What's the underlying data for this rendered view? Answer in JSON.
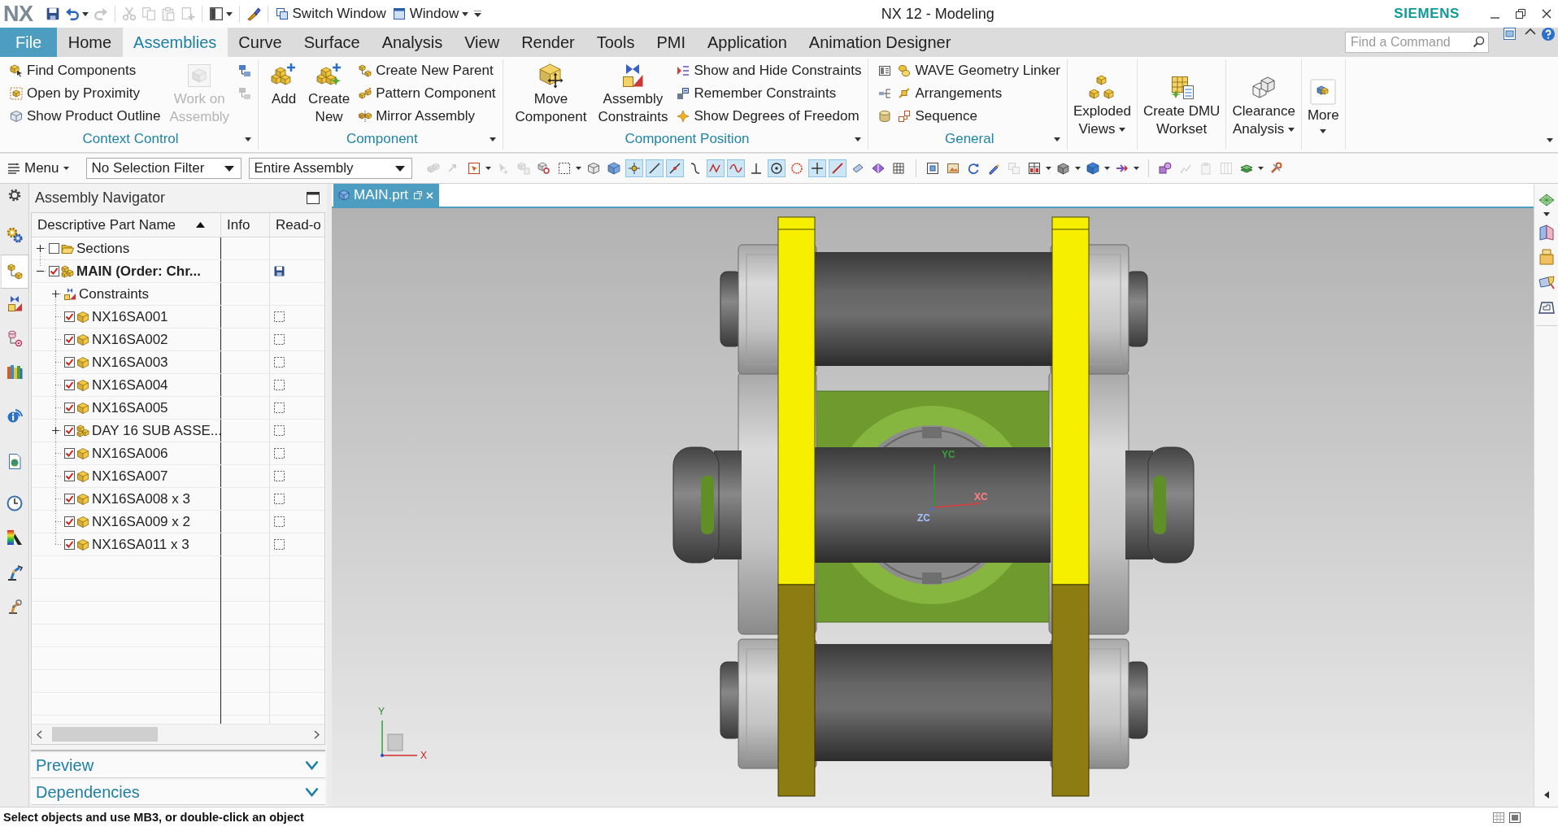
{
  "title_bar": {
    "logo": "NX",
    "quick_access": [
      {
        "kind": "icon",
        "disabled": false,
        "dropdown": false
      },
      {
        "kind": "icon",
        "disabled": false,
        "dropdown": true
      },
      {
        "kind": "icon",
        "disabled": true,
        "dropdown": false
      },
      {
        "kind": "icon",
        "disabled": true,
        "dropdown": false
      },
      {
        "kind": "icon",
        "disabled": true,
        "dropdown": false
      },
      {
        "kind": "icon",
        "disabled": true,
        "dropdown": false
      },
      {
        "kind": "icon",
        "disabled": true,
        "dropdown": false
      },
      {
        "kind": "icon",
        "disabled": false,
        "dropdown": true
      },
      {
        "kind": "icon",
        "disabled": false,
        "dropdown": false
      },
      {
        "kind": "button",
        "label": "Switch Window",
        "disabled": false,
        "dropdown": false
      },
      {
        "kind": "button",
        "label": "Window",
        "disabled": false,
        "dropdown": true
      }
    ],
    "title": "NX 12 - Modeling",
    "brand": "SIEMENS"
  },
  "ribbon_tabs": [
    {
      "label": "File",
      "kind": "backstage",
      "selected": false
    },
    {
      "label": "Home",
      "kind": "tab",
      "selected": false
    },
    {
      "label": "Assemblies",
      "kind": "tab",
      "selected": true
    },
    {
      "label": "Curve",
      "kind": "tab",
      "selected": false
    },
    {
      "label": "Surface",
      "kind": "tab",
      "selected": false
    },
    {
      "label": "Analysis",
      "kind": "tab",
      "selected": false
    },
    {
      "label": "View",
      "kind": "tab",
      "selected": false
    },
    {
      "label": "Render",
      "kind": "tab",
      "selected": false
    },
    {
      "label": "Tools",
      "kind": "tab",
      "selected": false
    },
    {
      "label": "PMI",
      "kind": "tab",
      "selected": false
    },
    {
      "label": "Application",
      "kind": "tab",
      "selected": false
    },
    {
      "label": "Animation Designer",
      "kind": "tab",
      "selected": false
    }
  ],
  "command_search": {
    "placeholder": "Find a Command"
  },
  "ribbon_groups": [
    {
      "label": "Context Control",
      "controls": [
        {
          "kind": "stack",
          "items": [
            {
              "label": "Find Components",
              "disabled": false
            },
            {
              "label": "Open by Proximity",
              "disabled": false
            },
            {
              "label": "Show Product Outline",
              "disabled": false
            }
          ]
        },
        {
          "kind": "large",
          "label": "Work on\nAssembly",
          "disabled": true,
          "dropdown": false
        },
        {
          "kind": "icons",
          "items": [
            {
              "disabled": false
            },
            {
              "disabled": true
            }
          ]
        }
      ]
    },
    {
      "label": "Component",
      "controls": [
        {
          "kind": "large",
          "label": "Add",
          "disabled": false,
          "dropdown": false
        },
        {
          "kind": "large",
          "label": "Create\nNew",
          "disabled": false,
          "dropdown": false
        },
        {
          "kind": "stack",
          "items": [
            {
              "label": "Create New Parent",
              "disabled": false
            },
            {
              "label": "Pattern Component",
              "disabled": false
            },
            {
              "label": "Mirror Assembly",
              "disabled": false
            }
          ]
        }
      ]
    },
    {
      "label": "Component Position",
      "controls": [
        {
          "kind": "large",
          "label": "Move\nComponent",
          "disabled": false,
          "dropdown": false
        },
        {
          "kind": "large",
          "label": "Assembly\nConstraints",
          "disabled": false,
          "dropdown": false
        },
        {
          "kind": "stack",
          "items": [
            {
              "label": "Show and Hide Constraints",
              "disabled": false
            },
            {
              "label": "Remember Constraints",
              "disabled": false
            },
            {
              "label": "Show Degrees of Freedom",
              "disabled": false
            }
          ]
        }
      ]
    },
    {
      "label": "General",
      "controls": [
        {
          "kind": "icons",
          "items": [
            {
              "disabled": false
            },
            {
              "disabled": false
            },
            {
              "disabled": false
            }
          ]
        },
        {
          "kind": "stack",
          "items": [
            {
              "label": "WAVE Geometry Linker",
              "disabled": false
            },
            {
              "label": "Arrangements",
              "disabled": false
            },
            {
              "label": "Sequence",
              "disabled": false
            }
          ]
        }
      ]
    },
    {
      "controls": [
        {
          "kind": "large",
          "label": "Exploded\nViews",
          "disabled": false,
          "dropdown": true
        }
      ]
    },
    {
      "controls": [
        {
          "kind": "large",
          "label": "Create DMU\nWorkset",
          "disabled": false,
          "dropdown": false
        }
      ]
    },
    {
      "controls": [
        {
          "kind": "large",
          "label": "Clearance\nAnalysis",
          "disabled": false,
          "dropdown": true
        }
      ]
    },
    {
      "controls": [
        {
          "kind": "large",
          "label": "More",
          "disabled": false,
          "dropdown": true
        }
      ]
    }
  ],
  "selection_bar": {
    "menu": "Menu",
    "filters": [
      {
        "value": "No Selection Filter"
      },
      {
        "value": "Entire Assembly"
      }
    ],
    "tools": [
      {
        "on": false,
        "disabled": true
      },
      {
        "on": false,
        "disabled": true
      },
      {
        "on": false,
        "disabled": false
      },
      {
        "on": false,
        "disabled": true
      },
      {
        "on": false,
        "disabled": true
      },
      {
        "on": false,
        "disabled": false
      },
      {
        "on": false,
        "disabled": false
      },
      {
        "on": false,
        "disabled": false
      },
      {
        "on": false,
        "disabled": false
      },
      {
        "on": true,
        "disabled": false
      },
      {
        "on": true,
        "disabled": false
      },
      {
        "on": true,
        "disabled": false
      },
      {
        "on": false,
        "disabled": false
      },
      {
        "on": true,
        "disabled": false
      },
      {
        "on": true,
        "disabled": false
      },
      {
        "on": false,
        "disabled": false
      },
      {
        "on": true,
        "disabled": false
      },
      {
        "on": false,
        "disabled": false
      },
      {
        "on": true,
        "disabled": false
      },
      {
        "on": true,
        "disabled": false
      },
      {
        "on": false,
        "disabled": false
      },
      {
        "on": false,
        "disabled": false
      },
      {
        "on": false,
        "disabled": false
      },
      {
        "on": false,
        "disabled": false
      },
      {
        "on": false,
        "disabled": false
      },
      {
        "on": false,
        "disabled": false
      },
      {
        "on": false,
        "disabled": false
      },
      {
        "on": false,
        "disabled": true
      },
      {
        "on": false,
        "disabled": false
      },
      {
        "on": false,
        "disabled": false
      },
      {
        "on": false,
        "disabled": false
      },
      {
        "on": false,
        "disabled": false
      },
      {
        "on": false,
        "disabled": false
      },
      {
        "on": false,
        "disabled": true
      },
      {
        "on": false,
        "disabled": true
      },
      {
        "on": false,
        "disabled": true
      },
      {
        "on": false,
        "disabled": false
      },
      {
        "on": false,
        "disabled": false
      }
    ]
  },
  "resource_bar": [
    {
      "selected": false
    },
    {
      "selected": true
    },
    {
      "selected": false
    },
    {
      "selected": false
    },
    {
      "selected": false
    },
    {
      "selected": false
    },
    {
      "selected": false
    },
    {
      "selected": false
    },
    {
      "selected": false
    },
    {
      "selected": false
    },
    {
      "selected": false
    }
  ],
  "assembly_navigator": {
    "title": "Assembly Navigator",
    "columns": [
      {
        "label": "Descriptive Part Name",
        "sorted": true
      },
      {
        "label": "Info",
        "sorted": false
      },
      {
        "label": "Read-o",
        "sorted": false
      }
    ],
    "nodes": [
      {
        "label": "Sections",
        "kind": "folder",
        "checked": false,
        "expanded": false,
        "work_part": false
      },
      {
        "label": "MAIN (Order: Chr...",
        "kind": "assembly",
        "checked": true,
        "expanded": true,
        "work_part": true,
        "modified": true,
        "children": [
          {
            "label": "Constraints",
            "kind": "constraints",
            "expanded": false,
            "work_part": false
          },
          {
            "label": "NX16SA001",
            "kind": "part",
            "checked": true,
            "work_part": false,
            "modified": false,
            "read_only": false
          },
          {
            "label": "NX16SA002",
            "kind": "part",
            "checked": true,
            "work_part": false,
            "modified": false,
            "read_only": false
          },
          {
            "label": "NX16SA003",
            "kind": "part",
            "checked": true,
            "work_part": false,
            "modified": false,
            "read_only": false
          },
          {
            "label": "NX16SA004",
            "kind": "part",
            "checked": true,
            "work_part": false,
            "modified": false,
            "read_only": false
          },
          {
            "label": "NX16SA005",
            "kind": "part",
            "checked": true,
            "work_part": false,
            "modified": false,
            "read_only": false
          },
          {
            "label": "DAY 16 SUB ASSE...",
            "kind": "assembly",
            "checked": true,
            "expanded": false,
            "work_part": false,
            "modified": false,
            "read_only": false
          },
          {
            "label": "NX16SA006",
            "kind": "part",
            "checked": true,
            "work_part": false,
            "modified": false,
            "read_only": false
          },
          {
            "label": "NX16SA007",
            "kind": "part",
            "checked": true,
            "work_part": false,
            "modified": false,
            "read_only": false
          },
          {
            "label": "NX16SA008 x 3",
            "kind": "part",
            "checked": true,
            "work_part": false,
            "modified": false,
            "read_only": false
          },
          {
            "label": "NX16SA009 x 2",
            "kind": "part",
            "checked": true,
            "work_part": false,
            "modified": false,
            "read_only": false
          },
          {
            "label": "NX16SA011 x 3",
            "kind": "part",
            "checked": true,
            "work_part": false,
            "modified": false,
            "read_only": false
          }
        ]
      }
    ],
    "panels": [
      {
        "label": "Preview",
        "expanded": false
      },
      {
        "label": "Dependencies",
        "expanded": false
      }
    ]
  },
  "viewport": {
    "tabs": [
      {
        "label": "MAIN.prt",
        "selected": true
      }
    ],
    "wcs": {
      "x_label": "XC",
      "y_label": "YC",
      "z_label": "ZC"
    },
    "view_triad": {
      "x_label": "X",
      "y_label": "Y"
    }
  },
  "status_bar": {
    "message": "Select objects and use MB3, or double-click an object"
  }
}
